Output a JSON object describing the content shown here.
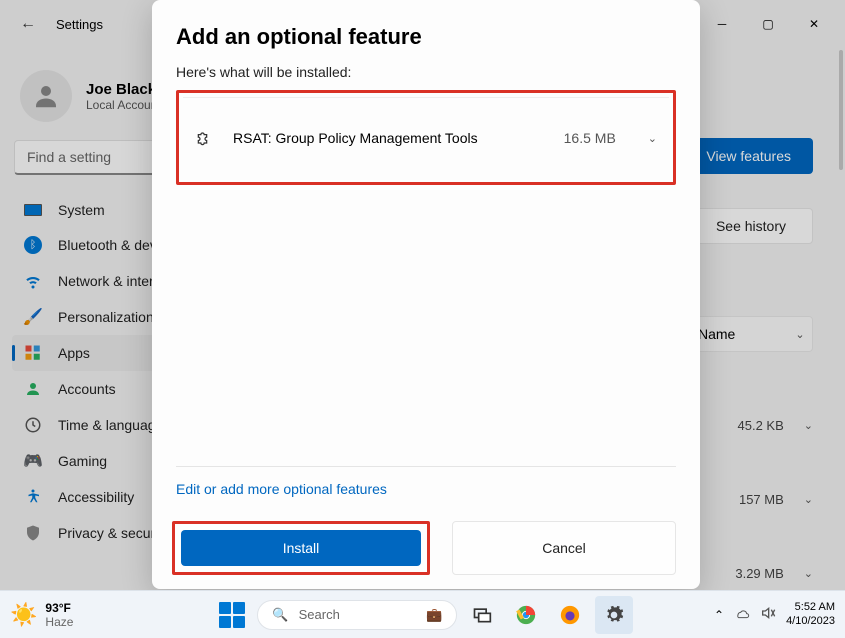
{
  "titlebar": {
    "title": "Settings"
  },
  "profile": {
    "name": "Joe Black",
    "subtitle": "Local Account"
  },
  "search": {
    "placeholder": "Find a setting"
  },
  "nav": {
    "system": "System",
    "bluetooth": "Bluetooth & devices",
    "network": "Network & internet",
    "personalization": "Personalization",
    "apps": "Apps",
    "accounts": "Accounts",
    "time": "Time & language",
    "gaming": "Gaming",
    "accessibility": "Accessibility",
    "privacy": "Privacy & security"
  },
  "content": {
    "view_features": "View features",
    "see_history": "See history",
    "sort_label": "Name",
    "rows": [
      {
        "size": "45.2 KB"
      },
      {
        "size": "157 MB"
      },
      {
        "size": "3.29 MB"
      }
    ]
  },
  "modal": {
    "title": "Add an optional feature",
    "subtitle": "Here's what will be installed:",
    "feature": {
      "name": "RSAT: Group Policy Management Tools",
      "size": "16.5 MB"
    },
    "edit_link": "Edit or add more optional features",
    "install": "Install",
    "cancel": "Cancel"
  },
  "taskbar": {
    "weather_temp": "93°F",
    "weather_cond": "Haze",
    "search_placeholder": "Search",
    "time": "5:52 AM",
    "date": "4/10/2023"
  }
}
